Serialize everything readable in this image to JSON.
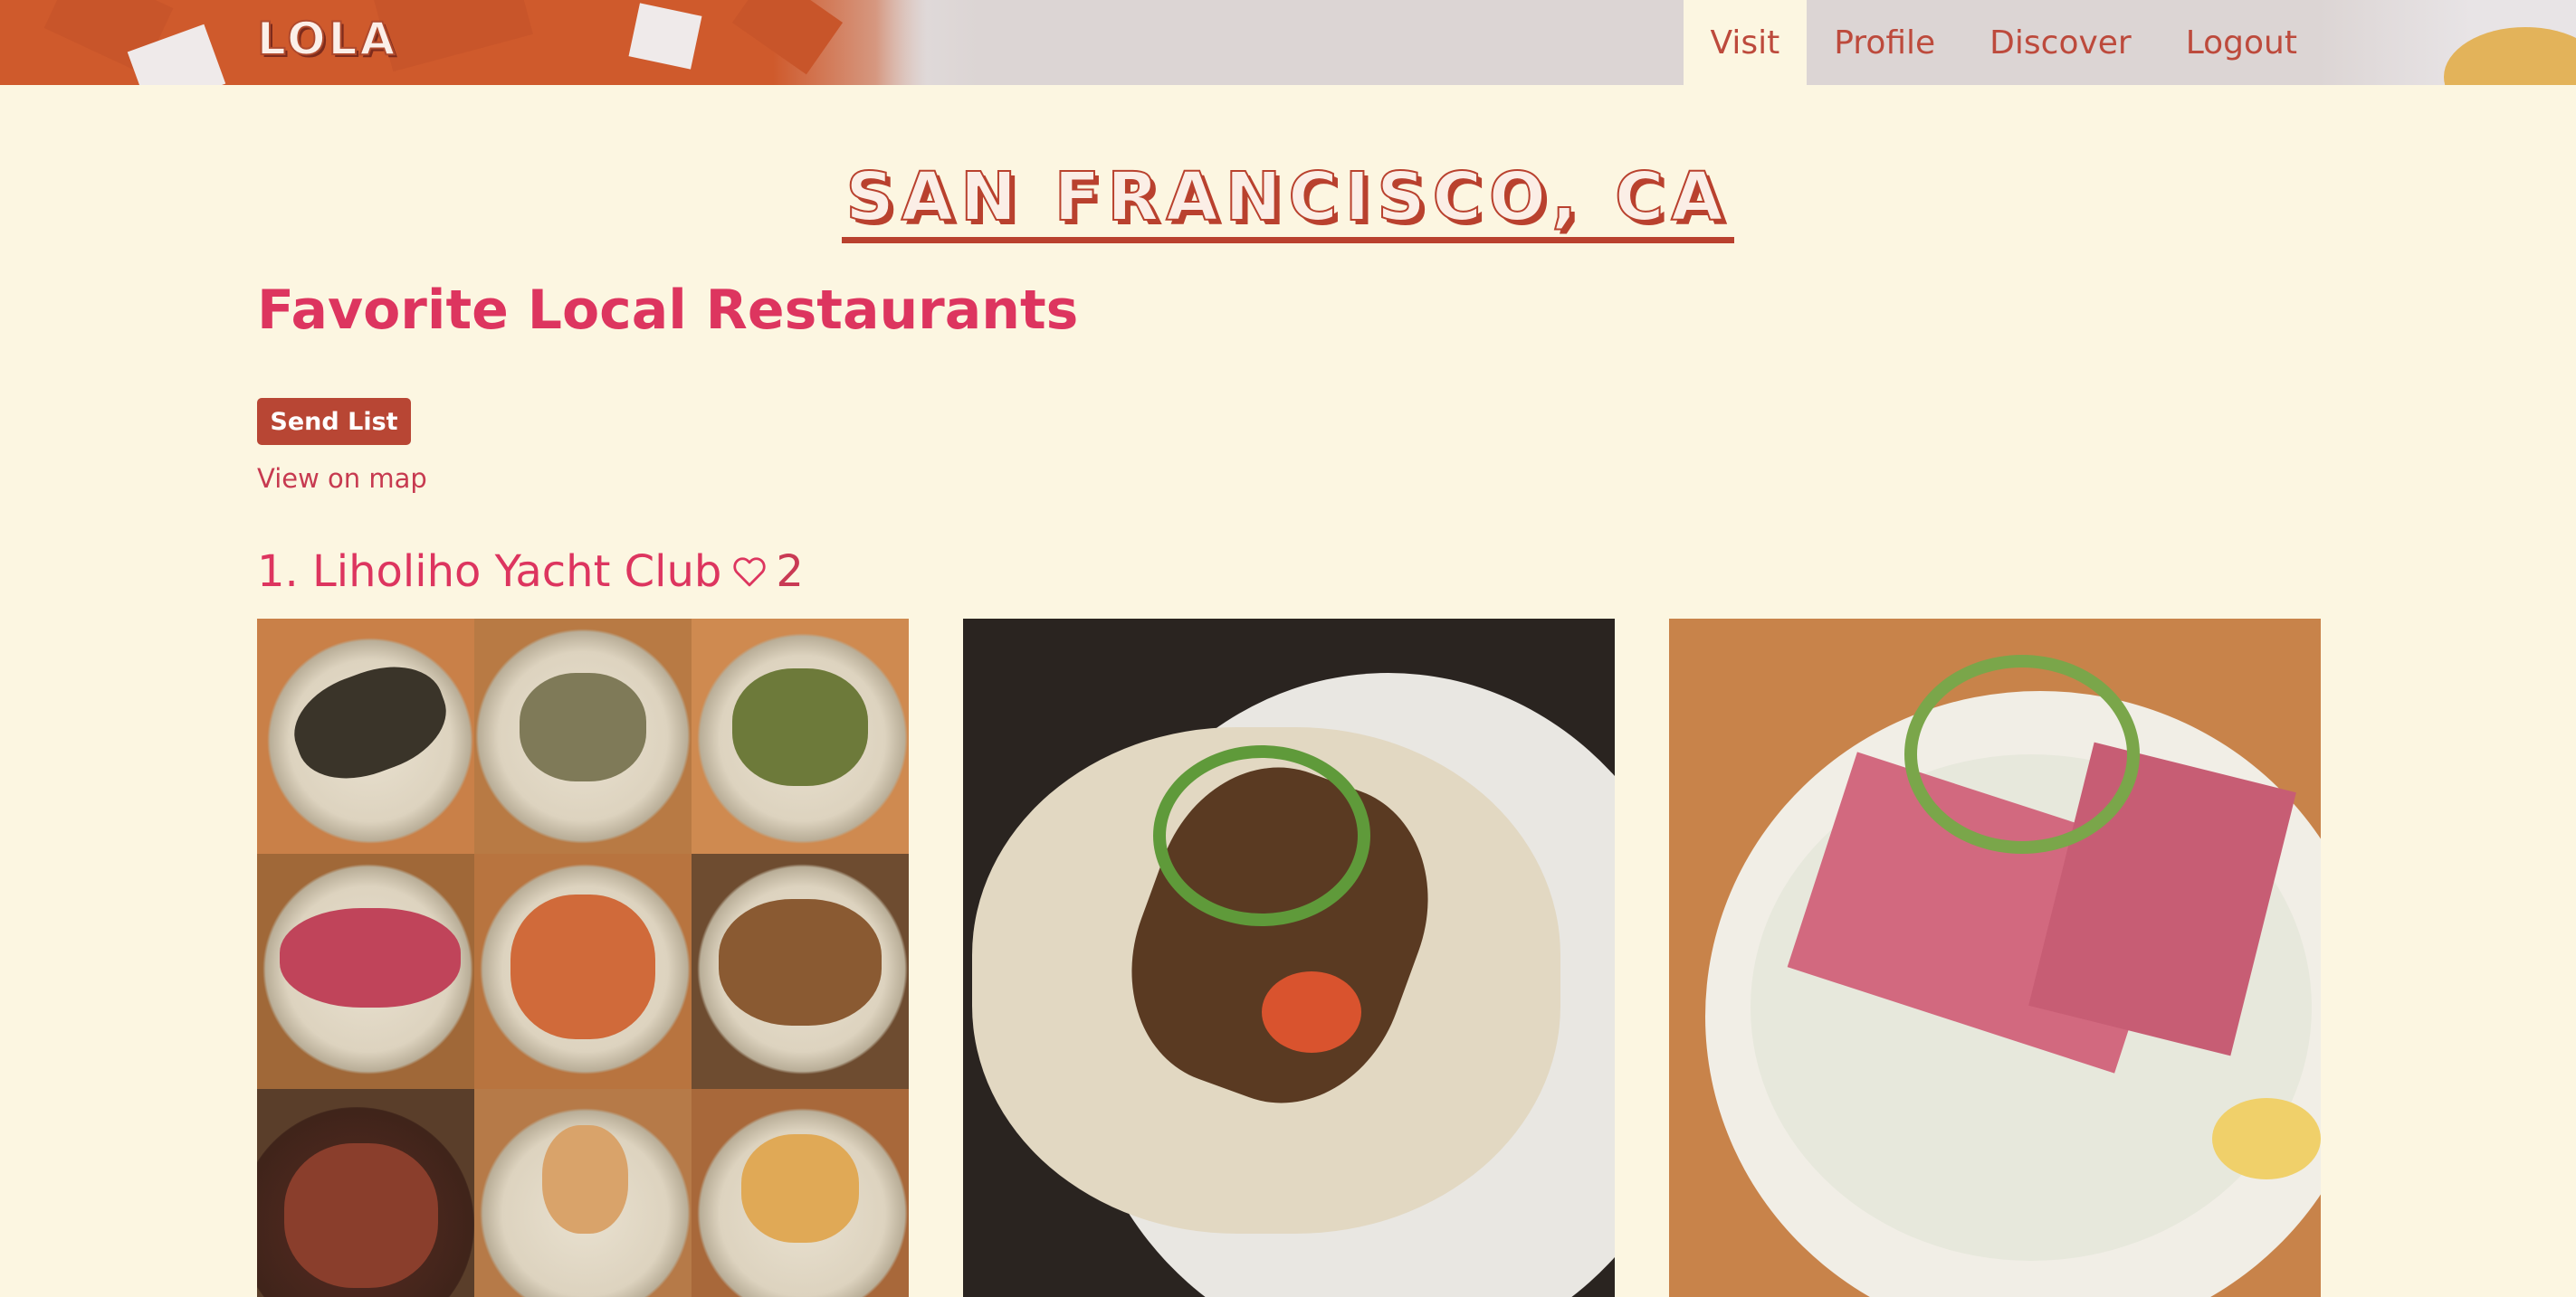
{
  "app": {
    "logo": "LOLA"
  },
  "nav": {
    "items": [
      {
        "label": "Visit",
        "active": true
      },
      {
        "label": "Profile",
        "active": false
      },
      {
        "label": "Discover",
        "active": false
      },
      {
        "label": "Logout",
        "active": false
      }
    ]
  },
  "page": {
    "city": "SAN FRANCISCO, CA",
    "section_heading": "Favorite Local Restaurants",
    "send_button": "Send List",
    "map_link": "View on map"
  },
  "restaurants": [
    {
      "number_name": "1. Liholiho Yacht Club",
      "likes": "2",
      "icon": "heart-outline-icon"
    }
  ],
  "colors": {
    "background": "#fcf6e1",
    "accent_pink": "#dd355f",
    "brick": "#b84634",
    "nav_text": "#bd4a3c"
  }
}
